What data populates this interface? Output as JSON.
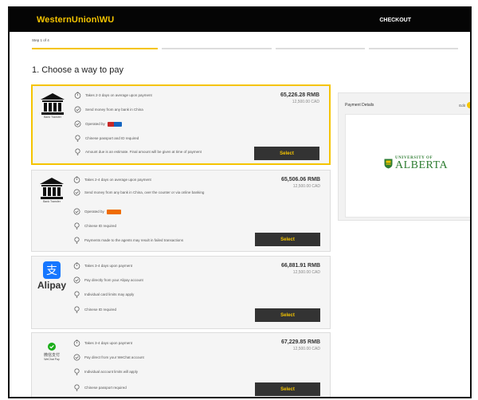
{
  "header": {
    "logo": "WesternUnion\\WU",
    "checkout": "CHECKOUT"
  },
  "steps": {
    "label": "Step 1 of 4"
  },
  "section_title": "1. Choose a way to pay",
  "payment_details": {
    "title": "Payment Details",
    "edit": "Edit",
    "institution_line1": "UNIVERSITY OF",
    "institution_line2": "ALBERTA"
  },
  "colors": {
    "accent": "#f5c400",
    "header_bg": "#050505",
    "button_bg": "#333333",
    "ua_green": "#2e7d32"
  },
  "options": [
    {
      "logo_icon": "bank-icon",
      "logo_caption": "Bank Transfer",
      "features": [
        "Takes 2-3 days on average upon payment",
        "Send money from any bank in China",
        "Operated by",
        "Chinese passport and ID required",
        "Amount due is an estimate. Final amount will be given at time of payment"
      ],
      "amount_rmb": "65,226.28 RMB",
      "amount_cad": "12,500.00 CAD",
      "select": "Select"
    },
    {
      "logo_icon": "bank-icon",
      "logo_caption": "Bank Transfer",
      "features": [
        "Takes 2-4 days on average upon payment",
        "Send money from any bank in China, over the counter or via online banking",
        "Operated by",
        "Chinese ID required",
        "Payments made to the agents may result in failed transactions"
      ],
      "amount_rmb": "65,506.06 RMB",
      "amount_cad": "12,500.00 CAD",
      "select": "Select"
    },
    {
      "logo_icon": "alipay-icon",
      "logo_caption": "Alipay",
      "features": [
        "Takes 3-4 days upon payment",
        "Pay directly from your Alipay account",
        "Individual card limits may apply",
        "Chinese ID required"
      ],
      "amount_rmb": "66,881.91 RMB",
      "amount_cad": "12,500.00 CAD",
      "select": "Select"
    },
    {
      "logo_icon": "wechat-pay-icon",
      "logo_caption": "微信支付",
      "logo_caption_en": "WeChat Pay",
      "features": [
        "Takes 3-4 days upon payment",
        "Pay direct from your WeChat account",
        "Individual account limits will apply",
        "Chinese passport required"
      ],
      "amount_rmb": "67,229.85 RMB",
      "amount_cad": "12,500.00 CAD",
      "select": "Select"
    }
  ]
}
